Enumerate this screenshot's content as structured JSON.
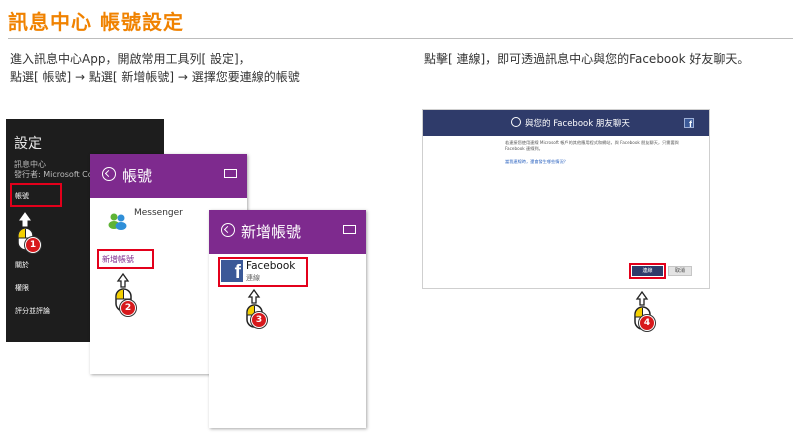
{
  "header": {
    "title": "訊息中心 帳號設定"
  },
  "left_instructions": {
    "line1": "進入訊息中心App，開啟常用工具列[ 設定]，",
    "line2": "點選[ 帳號] → 點選[ 新增帳號] → 選擇您要連線的帳號"
  },
  "right_instructions": {
    "line1": "點擊[ 連線]，即可透過訊息中心與您的Facebook 好友聊天。"
  },
  "settings_panel": {
    "title": "設定",
    "app_name": "訊息中心",
    "publisher": "發行者: Microsoft Co",
    "items": [
      "帳號",
      "關於",
      "權限",
      "評分並評論"
    ]
  },
  "accounts_panel": {
    "title": "帳號",
    "messenger_label": "Messenger",
    "add_account": "新增帳號"
  },
  "add_account_panel": {
    "title": "新增帳號",
    "facebook_label": "Facebook",
    "connect_sub": "連線"
  },
  "facebook_window": {
    "title": "與您的 Facebook 朋友聊天",
    "fb_letter": "f",
    "body_text": "若連接您使用連線 Microsoft 帳戶的其他應用程式和網站，與 Facebook 朋友聊天，只需要與 Facebook 連線到。",
    "link_text": "當我連線時，還會發生哪些情況？",
    "connect_button": "連線",
    "cancel_button": "取消"
  },
  "steps": [
    "1",
    "2",
    "3",
    "4"
  ],
  "colors": {
    "title_orange": "#f08200",
    "highlight_red": "#e3001b",
    "metro_purple": "#7e2a8e",
    "facebook_blue": "#3b5998",
    "settings_dark": "#1d1d1d"
  }
}
